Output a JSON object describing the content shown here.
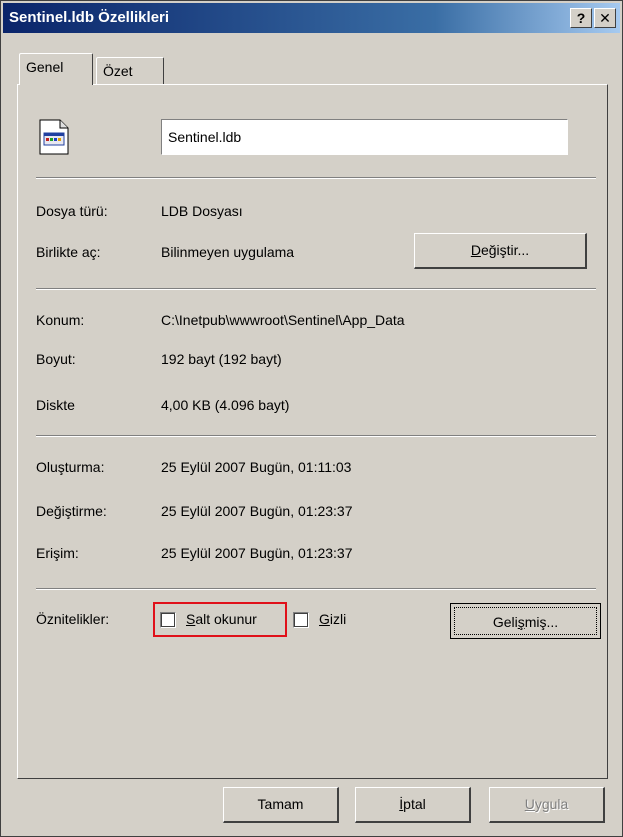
{
  "window": {
    "title": "Sentinel.ldb Özellikleri",
    "help_label": "?",
    "close_label": "✕"
  },
  "tabs": [
    {
      "label": "Genel",
      "active": true
    },
    {
      "label": "Özet",
      "active": false
    }
  ],
  "file": {
    "name": "Sentinel.ldb",
    "icon": "ldb-file-icon"
  },
  "general": {
    "type_label": "Dosya türü:",
    "type_value": "LDB Dosyası",
    "opens_label": "Birlikte aç:",
    "opens_value": "Bilinmeyen uygulama",
    "change_btn_prefix": "",
    "change_btn_underlined": "D",
    "change_btn_rest": "eğiştir..."
  },
  "location": {
    "location_label": "Konum:",
    "location_value": "C:\\Inetpub\\wwwroot\\Sentinel\\App_Data",
    "size_label": "Boyut:",
    "size_value": "192 bayt (192 bayt)",
    "disk_label": "Diskte",
    "disk_value": "4,00 KB (4.096 bayt)"
  },
  "dates": {
    "created_label": "Oluşturma:",
    "created_value": "25 Eylül 2007 Bugün, 01:11:03",
    "modified_label": "Değiştirme:",
    "modified_value": "25 Eylül 2007 Bugün, 01:23:37",
    "accessed_label": "Erişim:",
    "accessed_value": "25 Eylül 2007 Bugün, 01:23:37"
  },
  "attributes": {
    "label": "Öznitelikler:",
    "readonly_underlined": "S",
    "readonly_rest": "alt okunur",
    "readonly_checked": false,
    "hidden_underlined": "G",
    "hidden_rest": "izli",
    "hidden_checked": false,
    "advanced_prefix": "Geli",
    "advanced_underlined": "ş",
    "advanced_rest": "miş..."
  },
  "footer": {
    "ok_label": "Tamam",
    "cancel_underlined": "İ",
    "cancel_rest": "ptal",
    "apply_underlined": "U",
    "apply_rest": "ygula"
  },
  "colors": {
    "title_gradient_start": "#0a246a",
    "title_gradient_end": "#a6caf0",
    "face": "#d4d0c8",
    "highlight_box": "#e0101a"
  }
}
